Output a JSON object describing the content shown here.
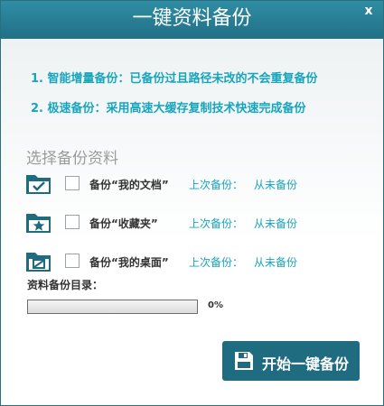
{
  "window": {
    "title": "一键资料备份",
    "close_glyph": "x"
  },
  "features": [
    "1. 智能增量备份：已备份过且路径未改的不会重复备份",
    "2. 极速备份：采用高速大缓存复制技术快速完成备份"
  ],
  "section_title": "选择备份资料",
  "items": [
    {
      "label": "备份“我的文档”",
      "last_label": "上次备份：",
      "last_value": "从未备份",
      "checked": false,
      "icon": "folder-check-icon"
    },
    {
      "label": "备份“收藏夹”",
      "last_label": "上次备份：",
      "last_value": "从未备份",
      "checked": false,
      "icon": "folder-star-icon"
    },
    {
      "label": "备份“我的桌面”",
      "last_label": "上次备份：",
      "last_value": "从未备份",
      "checked": false,
      "icon": "folder-desktop-icon"
    }
  ],
  "backup_dir_label": "资料备份目录：",
  "progress": {
    "value": 0,
    "text": "0%"
  },
  "start_button": {
    "label": "开始一键备份",
    "icon": "save-disk-icon"
  },
  "colors": {
    "accent": "#17a5be",
    "titlebar": "#2a7f94",
    "button": "#1f6b80"
  }
}
